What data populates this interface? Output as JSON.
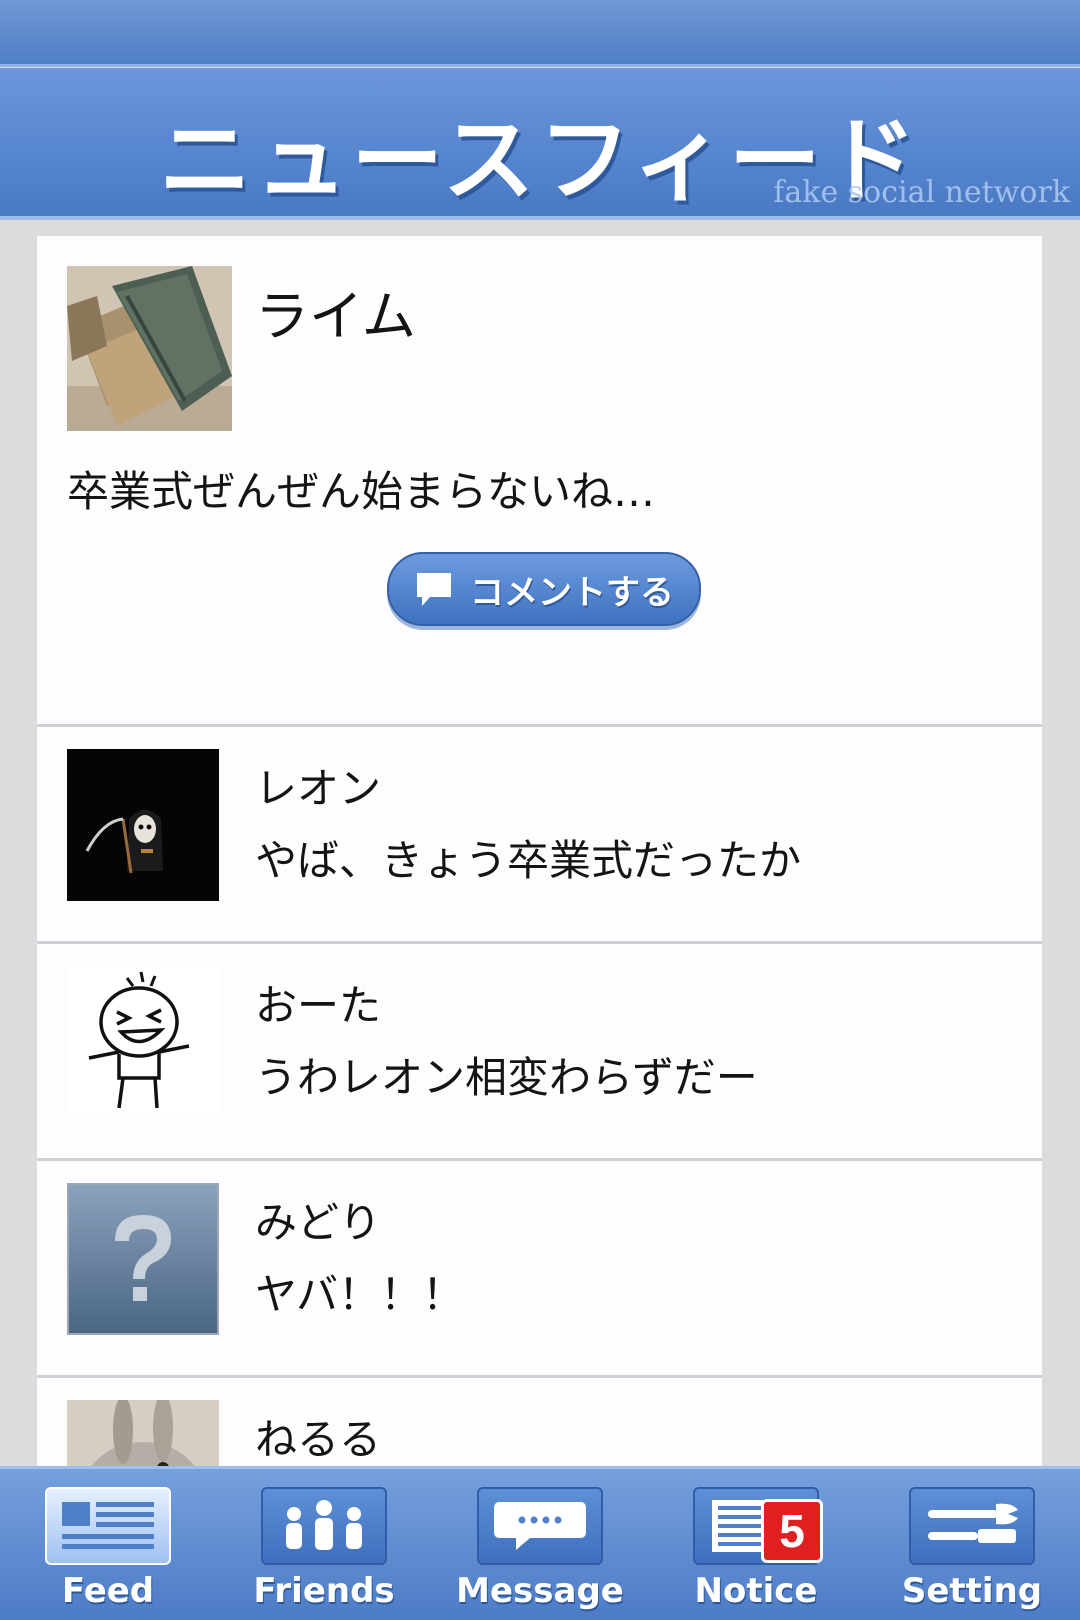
{
  "header": {
    "title": "ニュースフィード",
    "subtitle": "fake social network"
  },
  "feed": {
    "first_post": {
      "name": "ライム",
      "text": "卒業式ぜんぜん始まらないね…",
      "comment_label": "コメントする"
    },
    "posts": [
      {
        "name": "レオン",
        "text": "やば、きょう卒業式だったか"
      },
      {
        "name": "おーた",
        "text": "うわレオン相変わらずだー"
      },
      {
        "name": "みどり",
        "text": "ヤバ！！！"
      },
      {
        "name": "ねるる",
        "text": ""
      }
    ]
  },
  "tabbar": {
    "feed": "Feed",
    "friends": "Friends",
    "message": "Message",
    "notice": "Notice",
    "notice_badge": "5",
    "setting": "Setting"
  }
}
